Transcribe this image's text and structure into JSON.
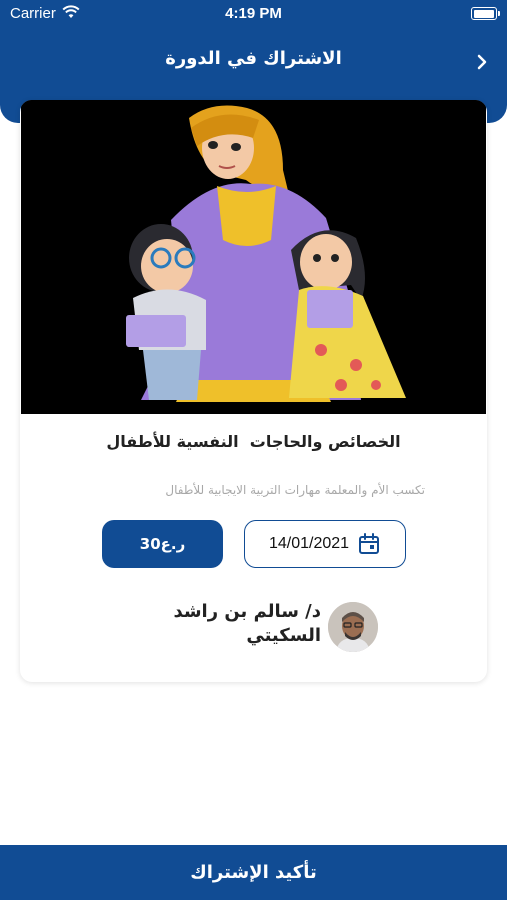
{
  "theme": {
    "brand": "#114c94",
    "card_bg": "#ffffff",
    "desc_color": "#a8a8a8"
  },
  "status_bar": {
    "carrier": "Carrier",
    "time": "4:19 PM",
    "battery_level": 1.0
  },
  "nav": {
    "title": "الاشتراك في الدورة",
    "back_icon": "chevron-right-icon"
  },
  "course": {
    "title": "الخصائص والحاجات  النفسية للأطفال",
    "description": "تكسب الأم والمعلمة مهارات التربية الايجابية للأطفال",
    "price": "30ر.ع",
    "date": "14/01/2021",
    "date_icon": "calendar-icon"
  },
  "instructor": {
    "name": "د/ سالم بن راشد السكيتي"
  },
  "footer": {
    "confirm_label": "تأكيد الإشتراك"
  }
}
